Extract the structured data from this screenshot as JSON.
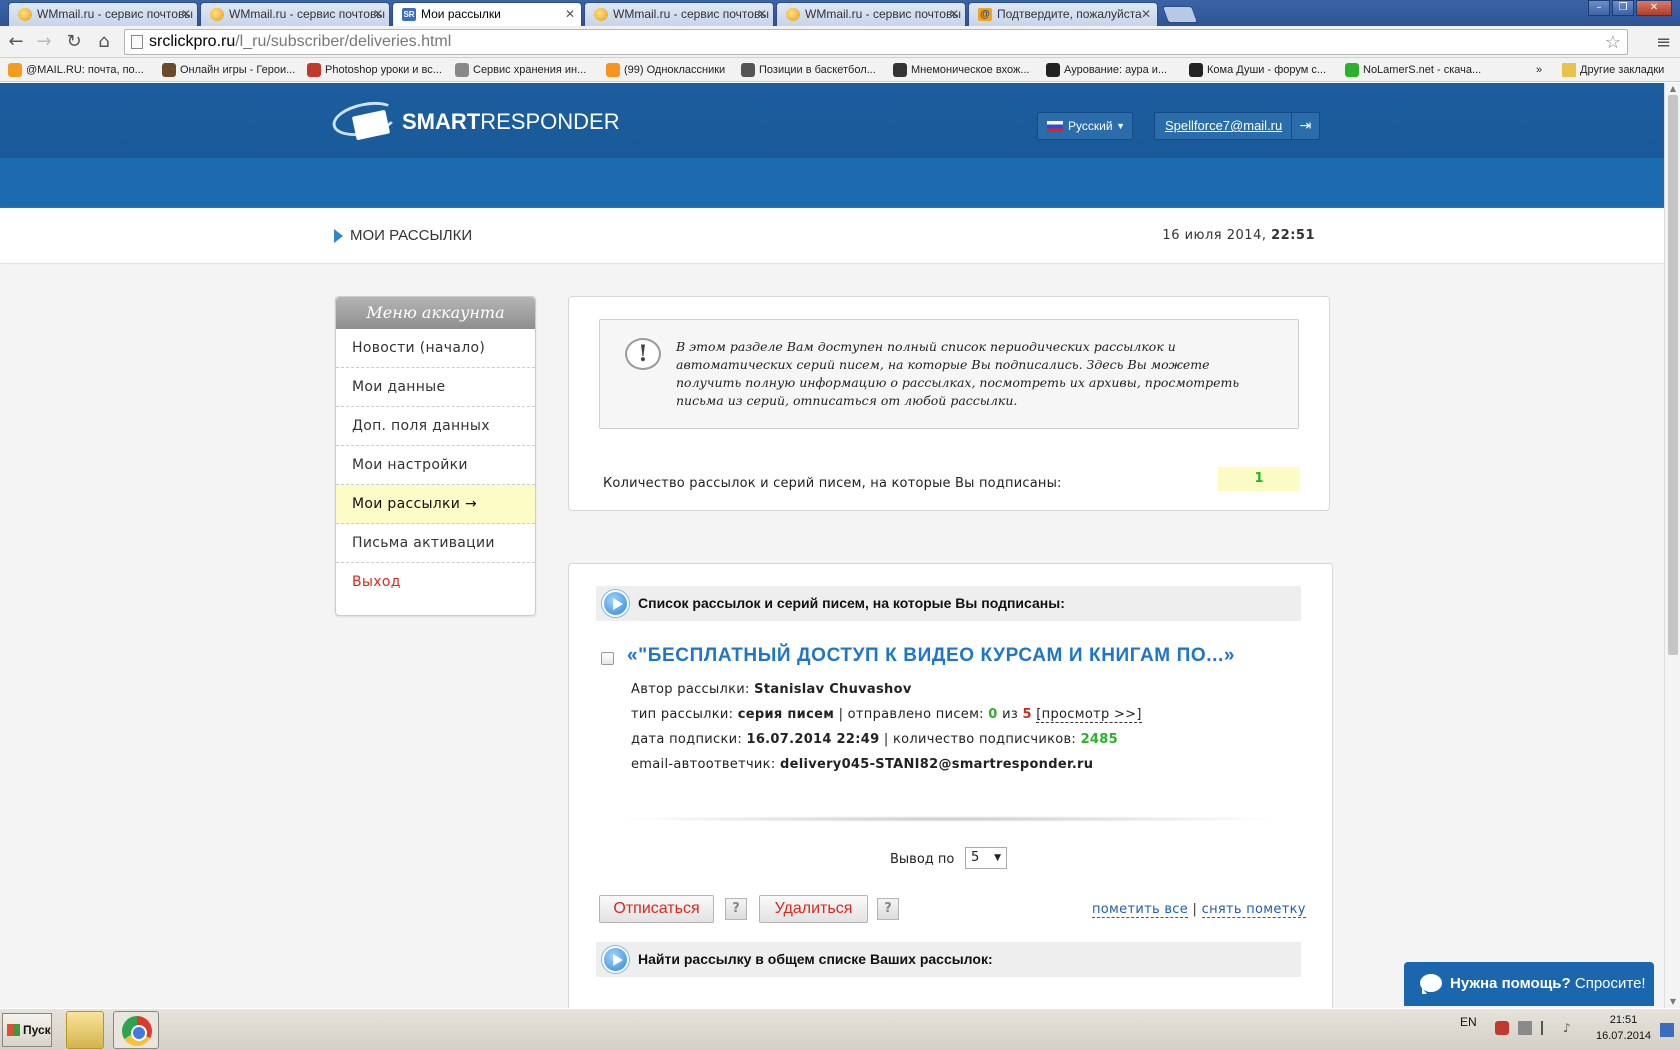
{
  "browser": {
    "tabs": [
      {
        "title": "WMmail.ru - сервис почтовы",
        "favicon": "wmmail-icon"
      },
      {
        "title": "WMmail.ru - сервис почтовы",
        "favicon": "wmmail-icon"
      },
      {
        "title": "Мои рассылки",
        "favicon": "smartresponder-icon",
        "active": true
      },
      {
        "title": "WMmail.ru - сервис почтовы",
        "favicon": "wmmail-icon"
      },
      {
        "title": "WMmail.ru - сервис почтовы",
        "favicon": "wmmail-icon"
      },
      {
        "title": "Подтвердите, пожалуйста",
        "favicon": "at-icon"
      }
    ],
    "url_host": "srclickpro.ru",
    "url_path": "/l_ru/subscriber/deliveries.html",
    "bookmarks": [
      {
        "label": "@MAIL.RU: почта, по...",
        "icon": "mailru-icon",
        "color": "#f39c1d"
      },
      {
        "label": "Онлайн игры - Герои...",
        "icon": "game-icon",
        "color": "#6b4a2a"
      },
      {
        "label": "Photoshop уроки и вс...",
        "icon": "photoshop-icon",
        "color": "#c0392b"
      },
      {
        "label": "Сервис хранения ин...",
        "icon": "ex-icon",
        "color": "#888888"
      },
      {
        "label": "(99) Одноклассники",
        "icon": "ok-icon",
        "color": "#f7931e"
      },
      {
        "label": "Позиции в баскетбол...",
        "icon": "wikipedia-icon",
        "color": "#555555"
      },
      {
        "label": "Мнемоническое вхож...",
        "icon": "site-icon",
        "color": "#333333"
      },
      {
        "label": "Аурование: аура и...",
        "icon": "skull-icon",
        "color": "#222222"
      },
      {
        "label": "Кома Души - форум с...",
        "icon": "skull-icon",
        "color": "#222222"
      },
      {
        "label": "NoLamerS.net - скача...",
        "icon": "check-icon",
        "color": "#2ab32a"
      }
    ],
    "bookmarks_overflow": "»",
    "other_bookmarks": "Другие закладки"
  },
  "header": {
    "logo_bold": "SMART",
    "logo_light": "RESPONDER",
    "language": "Русский",
    "user_email": "Spellforce7@mail.ru"
  },
  "breadcrumb": {
    "title": "МОИ РАССЫЛКИ",
    "date": "16 июля 2014,",
    "time": "22:51"
  },
  "sidebar": {
    "title": "Меню аккаунта",
    "items": [
      {
        "label": "Новости (начало)"
      },
      {
        "label": "Мои данные"
      },
      {
        "label": "Доп. поля данных"
      },
      {
        "label": "Мои настройки"
      },
      {
        "label": "Мои рассылки →"
      },
      {
        "label": "Письма активации"
      },
      {
        "label": "Выход"
      }
    ]
  },
  "info": {
    "notice": "В этом разделе Вам доступен полный список периодических рассылкок и автоматических серий писем, на которые Вы подписались. Здесь Вы можете получить полную информацию о рассылках, посмотреть их архивы, просмотреть письма из серий, отписаться от любой рассылки.",
    "count_label": "Количество рассылок и серий писем, на которые Вы подписаны:",
    "count_value": "1"
  },
  "deliveries": {
    "section_title": "Список рассылок и серий писем, на которые Вы подписаны:",
    "item": {
      "title": "«\"БЕСПЛАТНЫЙ ДОСТУП К ВИДЕО КУРСАМ И КНИГАМ ПО...»",
      "author_label": "Автор рассылки:",
      "author": "Stanislav Chuvashov",
      "type_label": "тип рассылки:",
      "type": "серия писем",
      "sent_label": "| отправлено писем:",
      "sent": "0",
      "of": "из",
      "total": "5",
      "view_link": "[просмотр >>]",
      "date_label": "дата подписки:",
      "date": "16.07.2014 22:49",
      "subs_label": "| количество подписчиков:",
      "subs": "2485",
      "email_label": "email-автоответчик:",
      "email": "delivery045-STANI82@smartresponder.ru"
    },
    "per_page_label": "Вывод по",
    "per_page_value": "5",
    "unsubscribe": "Отписаться",
    "delete": "Удалиться",
    "help_q": "?",
    "mark_all": "пометить все",
    "separator": "|",
    "unmark": "снять пометку",
    "search_title": "Найти рассылку в общем списке Ваших рассылок:"
  },
  "help_widget": {
    "bold": "Нужна помощь?",
    "text": " Спросите!"
  },
  "taskbar": {
    "start": "Пуск",
    "lang": "EN",
    "time": "21:51",
    "date": "16.07.2014"
  }
}
